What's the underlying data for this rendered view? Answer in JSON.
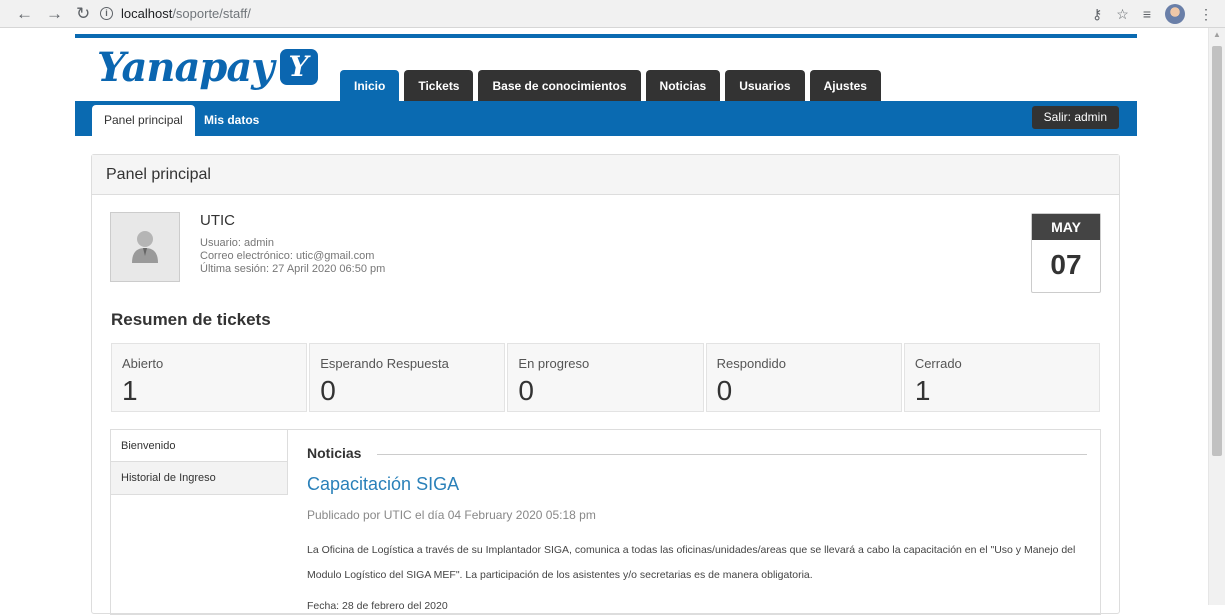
{
  "browser": {
    "url_host": "localhost",
    "url_path": "/soporte/staff/"
  },
  "brand": {
    "name": "Yanapay",
    "badge": "Y"
  },
  "main_tabs": [
    {
      "label": "Inicio"
    },
    {
      "label": "Tickets"
    },
    {
      "label": "Base de conocimientos"
    },
    {
      "label": "Noticias"
    },
    {
      "label": "Usuarios"
    },
    {
      "label": "Ajustes"
    }
  ],
  "sub_tabs": [
    {
      "label": "Panel principal"
    },
    {
      "label": "Mis datos"
    }
  ],
  "logout_label": "Salir: admin",
  "panel_title": "Panel principal",
  "user": {
    "name": "UTIC",
    "username": "Usuario: admin",
    "email": "Correo electrónico: utic@gmail.com",
    "last_session": "Última sesión: 27 April 2020 06:50 pm"
  },
  "date": {
    "month": "MAY",
    "day": "07"
  },
  "summary": {
    "title": "Resumen de tickets",
    "stats": [
      {
        "label": "Abierto",
        "value": "1"
      },
      {
        "label": "Esperando Respuesta",
        "value": "0"
      },
      {
        "label": "En progreso",
        "value": "0"
      },
      {
        "label": "Respondido",
        "value": "0"
      },
      {
        "label": "Cerrado",
        "value": "1"
      }
    ]
  },
  "side_tabs": [
    {
      "label": "Bienvenido"
    },
    {
      "label": "Historial de Ingreso"
    }
  ],
  "news": {
    "section": "Noticias",
    "title": "Capacitación SIGA",
    "byline": "Publicado por UTIC el día 04 February 2020 05:18 pm",
    "body": "La Oficina de Logística a través de su Implantador SIGA, comunica a todas las oficinas/unidades/areas que se llevará a cabo la capacitación en el \"Uso y Manejo del Modulo Logístico del SIGA MEF\". La participación de los asistentes y/o secretarias es de manera obligatoria.",
    "date": "Fecha: 28 de febrero del 2020"
  },
  "colors": {
    "primary": "#0a6ab1",
    "dark": "#333333",
    "link": "#2a80b9"
  }
}
